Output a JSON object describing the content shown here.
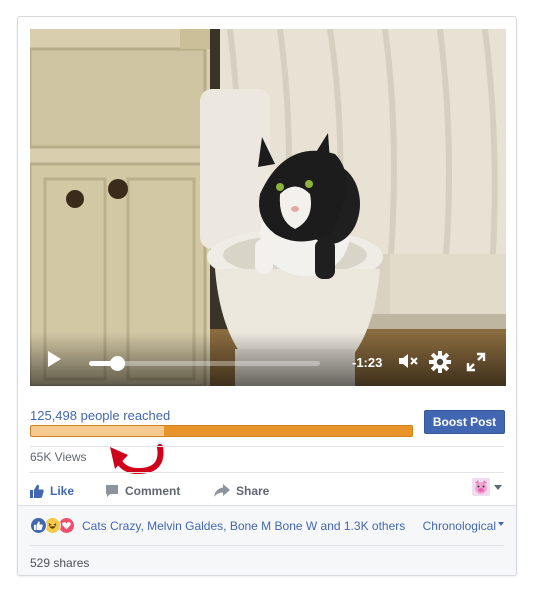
{
  "video": {
    "time_remaining": "-1:23",
    "progress": 0.12
  },
  "reach": {
    "label": "125,498 people reached",
    "organic_fraction": 0.35,
    "boost_button_label": "Boost Post"
  },
  "stats": {
    "views": "65K Views"
  },
  "actions": {
    "like_label": "Like",
    "comment_label": "Comment",
    "share_label": "Share"
  },
  "reactions": {
    "summary": "Cats Crazy, Melvin Galdes, Bone M Bone W and 1.3K others",
    "sort_label": "Chronological",
    "shares": "529 shares",
    "icons": [
      "like-reaction-icon",
      "haha-reaction-icon",
      "love-reaction-icon"
    ]
  },
  "colors": {
    "accent": "#4267b2",
    "reach_paid": "#e8942a",
    "reach_organic": "#f5c98f",
    "annotation_arrow": "#d0021b"
  }
}
